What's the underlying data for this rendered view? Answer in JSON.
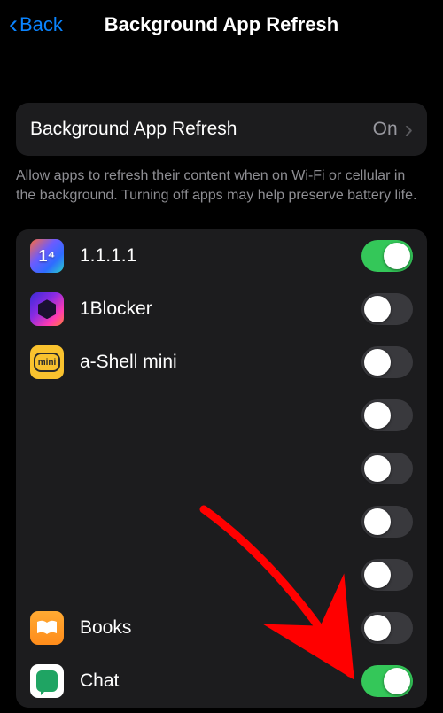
{
  "nav": {
    "back_label": "Back",
    "title": "Background App Refresh"
  },
  "master": {
    "label": "Background App Refresh",
    "value": "On"
  },
  "footer": "Allow apps to refresh their content when on Wi-Fi or cellular in the background. Turning off apps may help preserve battery life.",
  "apps": [
    {
      "name": "1.1.1.1",
      "enabled": true,
      "icon": "cloudflare"
    },
    {
      "name": "1Blocker",
      "enabled": false,
      "icon": "1blocker"
    },
    {
      "name": "a-Shell mini",
      "enabled": false,
      "icon": "ashell"
    },
    {
      "name": "",
      "enabled": false,
      "icon": ""
    },
    {
      "name": "",
      "enabled": false,
      "icon": ""
    },
    {
      "name": "",
      "enabled": false,
      "icon": ""
    },
    {
      "name": "",
      "enabled": false,
      "icon": ""
    },
    {
      "name": "Books",
      "enabled": false,
      "icon": "books"
    },
    {
      "name": "Chat",
      "enabled": true,
      "icon": "chat"
    }
  ],
  "annotation": {
    "arrow_color": "#ff0000"
  }
}
